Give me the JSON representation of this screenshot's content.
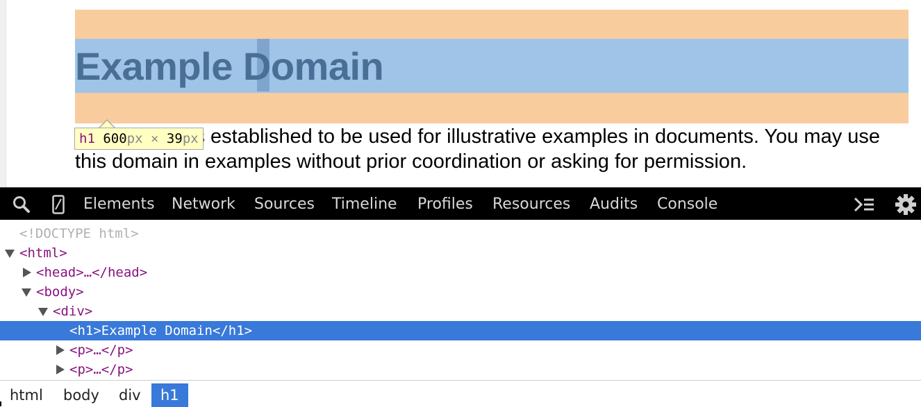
{
  "page": {
    "heading": "Example Domain",
    "paragraph": "This domain is established to be used for illustrative examples in documents. You may use this domain in examples without prior coordination or asking for permission."
  },
  "tooltip": {
    "tag": "h1",
    "width": "600",
    "unit": "px",
    "times": "×",
    "height": "39"
  },
  "colors": {
    "margin_overlay": "#f9cc9d",
    "content_overlay": "#9fc4e7",
    "selection": "#3879d9",
    "tag": "#881280"
  },
  "toolbar": {
    "icons": [
      "search-icon",
      "device-mode-icon",
      "console-drawer-icon",
      "gear-icon"
    ],
    "tabs": [
      "Elements",
      "Network",
      "Sources",
      "Timeline",
      "Profiles",
      "Resources",
      "Audits",
      "Console"
    ]
  },
  "tree": {
    "doctype": "<!DOCTYPE html>",
    "html_open": "<html>",
    "head": "<head>…</head>",
    "body_open": "<body>",
    "div_open": "<div>",
    "h1_line": "<h1>Example Domain</h1>",
    "p1": "<p>…</p>",
    "p2": "<p>…</p>"
  },
  "breadcrumbs": [
    "html",
    "body",
    "div",
    "h1"
  ]
}
